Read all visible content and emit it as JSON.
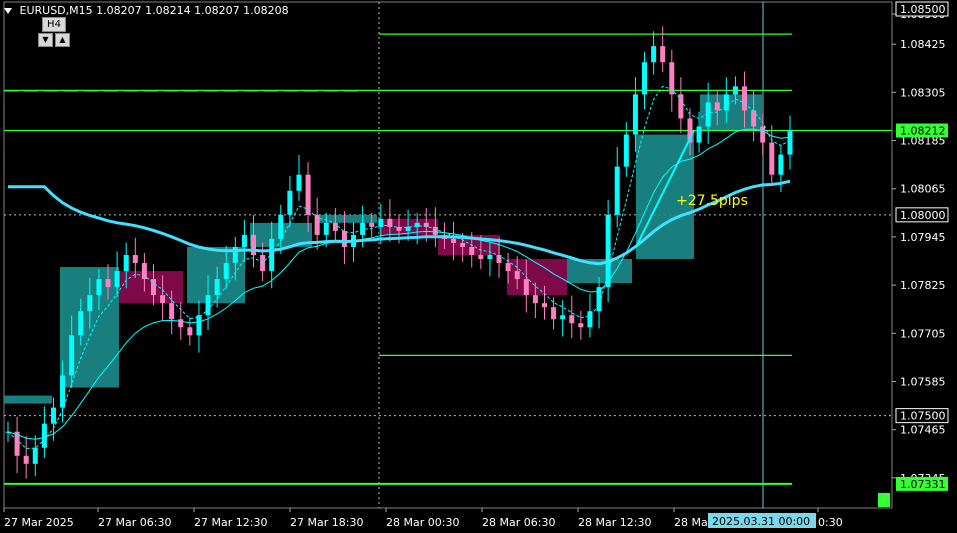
{
  "header": {
    "symbol": "EURUSD,M15",
    "ohlc": "1.08207 1.08214 1.08207 1.08208"
  },
  "timeframe": {
    "label": "H4",
    "down_icon": "triangle-down-icon",
    "up_icon": "triangle-up-icon"
  },
  "annotation": {
    "text": "+27.5pips",
    "color": "#ffff00"
  },
  "colors": {
    "background": "#000000",
    "bull_candle": "#00ffff",
    "bear_candle": "#ff80c0",
    "bull_box": "#1b8c8c",
    "bear_box": "#8b0a50",
    "ma_fast": "#00ffff",
    "ma_thick": "#40e0ff",
    "level_line": "#33ff33",
    "price_label_bg": "#33ff33"
  },
  "chart_data": {
    "type": "candlestick",
    "ylim": [
      1.0727,
      1.0853
    ],
    "y_ticks": [
      "1.08500",
      "1.08425",
      "1.08305",
      "1.08185",
      "1.08065",
      "1.07945",
      "1.07825",
      "1.07705",
      "1.07585",
      "1.07465",
      "1.07345"
    ],
    "x_ticks": [
      "27 Mar 2025",
      "27 Mar 06:30",
      "27 Mar 12:30",
      "27 Mar 18:30",
      "28 Mar 00:30",
      "28 Mar 06:30",
      "28 Mar 12:30",
      "28 Ma",
      "0:30"
    ],
    "crosshair_time": "2025.03.31 00:00",
    "current_price": "1.08212",
    "level_labels": {
      "top": "1.08500",
      "mid": "1.08000",
      "low": "1.07500",
      "bottom": "1.07331"
    },
    "levels": [
      1.0845,
      1.0831,
      1.0821,
      1.0765,
      1.0733
    ],
    "dashed_level": 1.0831,
    "series_close": [
      1.0746,
      1.074,
      1.0738,
      1.0742,
      1.0748,
      1.0752,
      1.076,
      1.077,
      1.0776,
      1.078,
      1.0784,
      1.0782,
      1.0786,
      1.079,
      1.0788,
      1.0784,
      1.078,
      1.0778,
      1.0774,
      1.0772,
      1.077,
      1.0775,
      1.078,
      1.0784,
      1.0788,
      1.0792,
      1.0795,
      1.079,
      1.0786,
      1.0794,
      1.08,
      1.0806,
      1.081,
      1.08,
      1.0795,
      1.0798,
      1.0796,
      1.0792,
      1.0795,
      1.0798,
      1.0797,
      1.0799,
      1.0797,
      1.0796,
      1.0797,
      1.0798,
      1.0797,
      1.0795,
      1.0794,
      1.0793,
      1.0792,
      1.079,
      1.0789,
      1.079,
      1.0788,
      1.0786,
      1.0784,
      1.078,
      1.0778,
      1.0777,
      1.0774,
      1.0775,
      1.0773,
      1.0772,
      1.0776,
      1.0782,
      1.08,
      1.0812,
      1.082,
      1.083,
      1.0838,
      1.0842,
      1.0838,
      1.083,
      1.0824,
      1.0818,
      1.0822,
      1.0828,
      1.0826,
      1.083,
      1.0832,
      1.0826,
      1.0822,
      1.0818,
      1.081,
      1.0815,
      1.0821
    ]
  }
}
